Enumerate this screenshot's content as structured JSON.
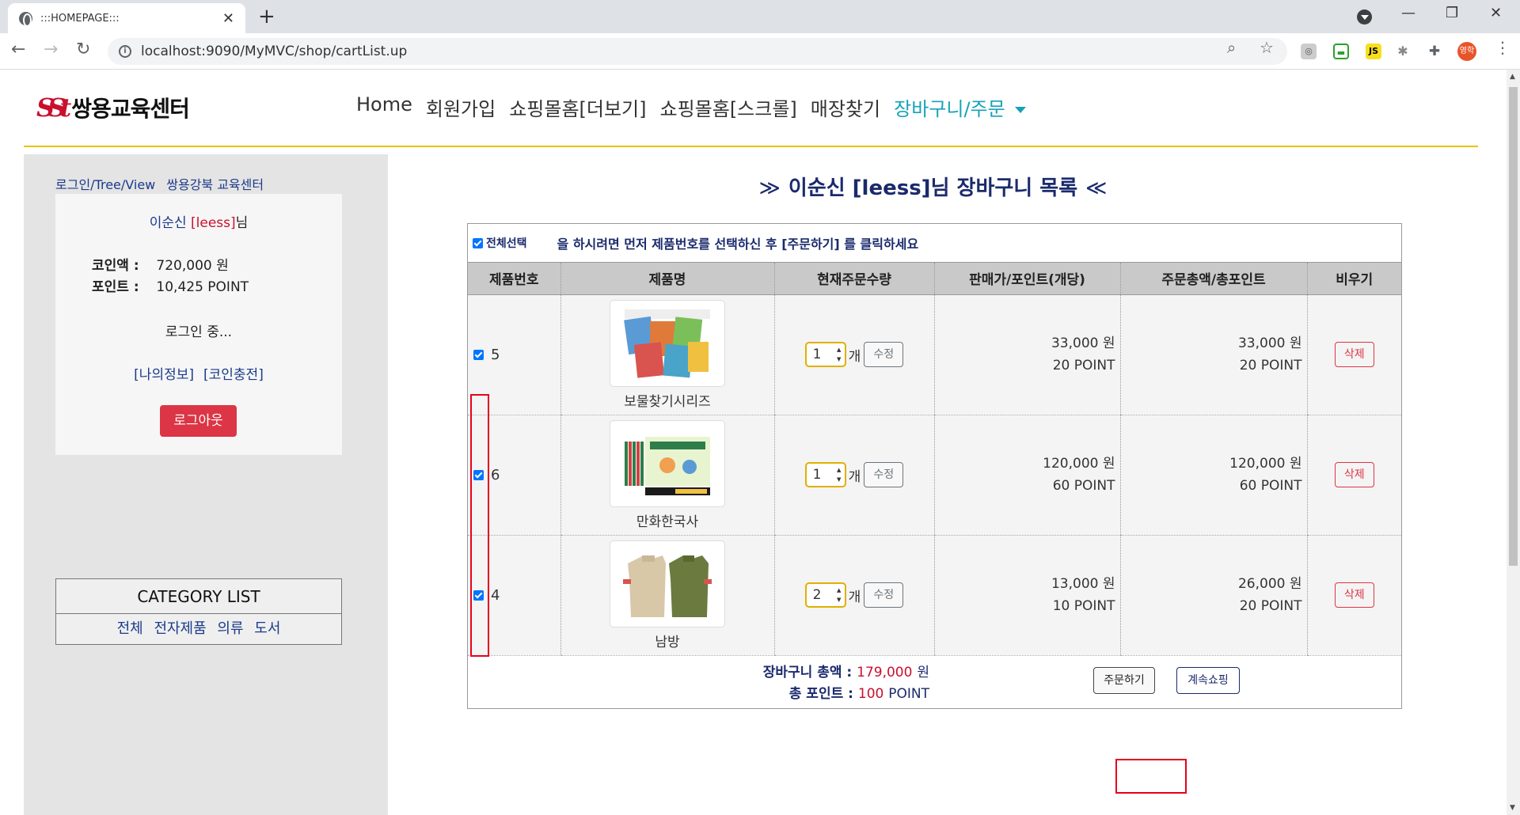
{
  "browser": {
    "tab_title": ":::HOMEPAGE:::",
    "url": "localhost:9090/MyMVC/shop/cartList.up",
    "profile_initial": "영학",
    "ext_js": "JS"
  },
  "header": {
    "logo_text": "쌍용교육센터",
    "logo_mark": "SSt",
    "nav": [
      "Home",
      "회원가입",
      "쇼핑몰홈[더보기]",
      "쇼핑몰홈[스크롤]",
      "매장찾기"
    ],
    "nav_active": "장바구니/주문"
  },
  "sidebar": {
    "link1": "로그인/Tree/View",
    "link2": "쌍용강북 교육센터",
    "user_name": "이순신",
    "user_id": "[leess]",
    "user_suffix": "님",
    "coin_label": "코인액 :",
    "coin_value": "720,000 원",
    "point_label": "포인트 :",
    "point_value": "10,425 POINT",
    "status": "로그인 중...",
    "myinfo": "[나의정보]",
    "charge": "[코인충전]",
    "logout": "로그아웃",
    "category_title": "CATEGORY LIST",
    "categories": [
      "전체",
      "전자제품",
      "의류",
      "도서"
    ]
  },
  "cart": {
    "title": "이순신 [leess]님 장바구니 목록",
    "title_left": "≫",
    "title_right": "≪",
    "select_all": "전체선택",
    "instruction": "을 하시려면 먼저 제품번호를 선택하신 후 [주문하기] 를 클릭하세요",
    "headers": [
      "제품번호",
      "제품명",
      "현재주문수량",
      "판매가/포인트(개당)",
      "주문총액/총포인트",
      "비우기"
    ],
    "items": [
      {
        "no": "5",
        "name": "보물찾기시리즈",
        "qty": "1",
        "unit": "개",
        "edit": "수정",
        "price": "33,000 원",
        "price_point": "20 POINT",
        "total": "33,000 원",
        "total_point": "20 POINT",
        "delete": "삭제"
      },
      {
        "no": "6",
        "name": "만화한국사",
        "qty": "1",
        "unit": "개",
        "edit": "수정",
        "price": "120,000 원",
        "price_point": "60 POINT",
        "total": "120,000 원",
        "total_point": "60 POINT",
        "delete": "삭제"
      },
      {
        "no": "4",
        "name": "남방",
        "qty": "2",
        "unit": "개",
        "edit": "수정",
        "price": "13,000 원",
        "price_point": "10 POINT",
        "total": "26,000 원",
        "total_point": "20 POINT",
        "delete": "삭제"
      }
    ],
    "sum_label": "장바구니 총액 :",
    "sum_value": "179,000",
    "sum_unit": "원",
    "point_label": "총 포인트 :",
    "point_value": "100",
    "point_unit": "POINT",
    "order_btn": "주문하기",
    "shop_btn": "계속쇼핑"
  }
}
